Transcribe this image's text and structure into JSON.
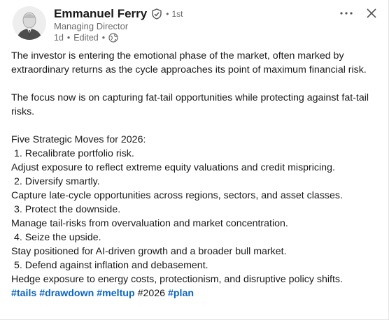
{
  "author": {
    "name": "Emmanuel Ferry",
    "degree": "1st",
    "headline": "Managing Director",
    "posted": "1d",
    "edited": "Edited"
  },
  "post": {
    "p1": "The investor is entering the emotional phase of the market, often marked by extraordinary returns as the cycle approaches its point of maximum financial risk.",
    "p2": "The focus now is on capturing fat-tail opportunities while protecting against fat-tail risks.",
    "list_title": "Five Strategic Moves for 2026:",
    "moves": [
      {
        "title": " 1. Recalibrate portfolio risk.",
        "detail": "Adjust exposure to reflect extreme equity valuations and credit mispricing."
      },
      {
        "title": " 2. Diversify smartly.",
        "detail": "Capture late-cycle opportunities across regions, sectors, and asset classes."
      },
      {
        "title": " 3. Protect the downside.",
        "detail": "Manage tail-risks from overvaluation and market concentration."
      },
      {
        "title": " 4. Seize the upside.",
        "detail": "Stay positioned for AI-driven growth and a broader bull market."
      },
      {
        "title": " 5. Defend against inflation and debasement.",
        "detail": "Hedge exposure to energy costs, protectionism, and disruptive policy shifts."
      }
    ],
    "hashtags": [
      "#tails",
      "#drawdown",
      "#meltup",
      "#2026",
      "#plan"
    ]
  },
  "colors": {
    "link": "#0a66c2",
    "text": "#1a1a1a",
    "muted": "#666666"
  },
  "icons": {
    "verified": "verified-shield-icon",
    "visibility": "globe-icon",
    "more": "more-horizontal-icon",
    "close": "close-icon"
  }
}
